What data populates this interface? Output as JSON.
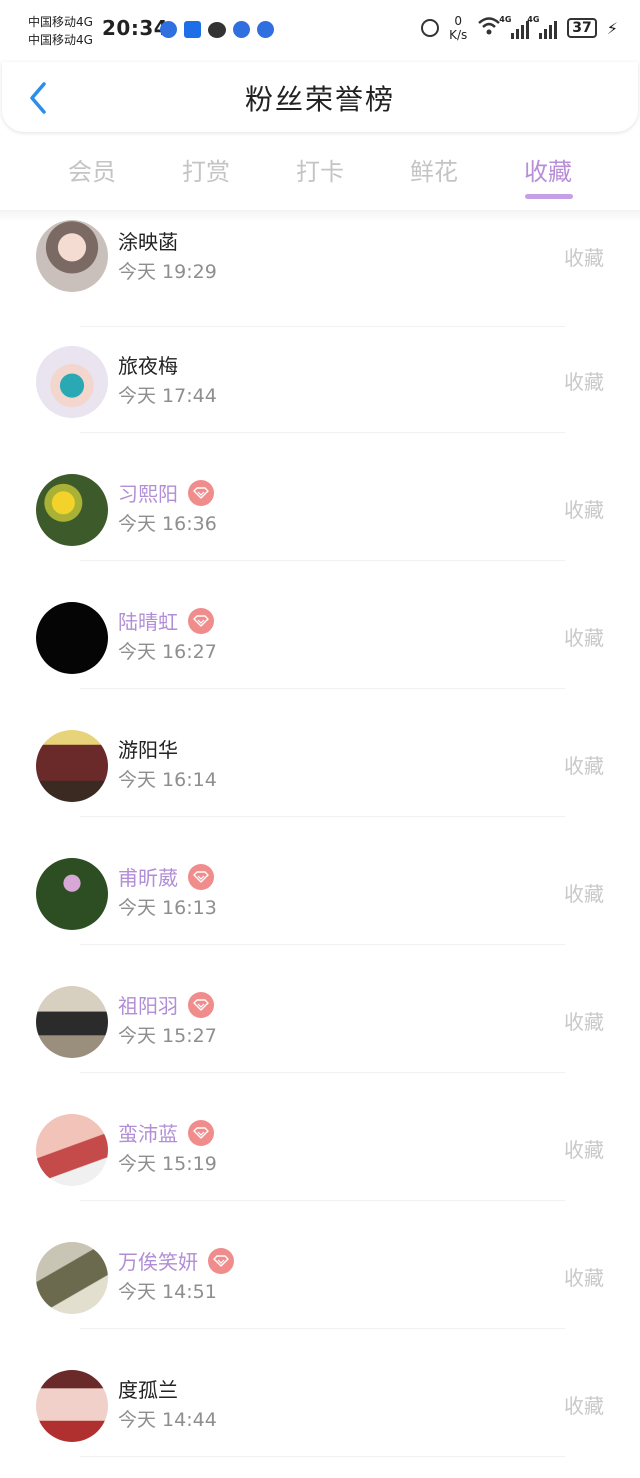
{
  "status_bar": {
    "carrier1": "中国移动4G",
    "carrier2": "中国移动4G",
    "time": "20:34",
    "net_speed_value": "0",
    "net_speed_unit": "K/s",
    "signal1_label": "4G",
    "signal2_label": "4G",
    "battery": "37"
  },
  "header": {
    "title": "粉丝荣誉榜",
    "back_icon": "chevron-left-icon"
  },
  "tabs": [
    {
      "label": "会员",
      "active": false
    },
    {
      "label": "打赏",
      "active": false
    },
    {
      "label": "打卡",
      "active": false
    },
    {
      "label": "鲜花",
      "active": false
    },
    {
      "label": "收藏",
      "active": true
    }
  ],
  "fans": [
    {
      "name": "涂映菡",
      "time": "今天 19:29",
      "vip": false,
      "action": "收藏"
    },
    {
      "name": "旅夜梅",
      "time": "今天 17:44",
      "vip": false,
      "action": "收藏"
    },
    {
      "name": "习熙阳",
      "time": "今天 16:36",
      "vip": true,
      "action": "收藏"
    },
    {
      "name": "陆晴虹",
      "time": "今天 16:27",
      "vip": true,
      "action": "收藏"
    },
    {
      "name": "游阳华",
      "time": "今天 16:14",
      "vip": false,
      "action": "收藏"
    },
    {
      "name": "甫昕葳",
      "time": "今天 16:13",
      "vip": true,
      "action": "收藏"
    },
    {
      "name": "祖阳羽",
      "time": "今天 15:27",
      "vip": true,
      "action": "收藏"
    },
    {
      "name": "蛮沛蓝",
      "time": "今天 15:19",
      "vip": true,
      "action": "收藏"
    },
    {
      "name": "万俟笑妍",
      "time": "今天 14:51",
      "vip": true,
      "action": "收藏"
    },
    {
      "name": "度孤兰",
      "time": "今天 14:44",
      "vip": false,
      "action": "收藏"
    }
  ],
  "colors": {
    "accent": "#b88ed8",
    "vip_name": "#b28ed6",
    "vip_badge": "#f08c8c",
    "back_arrow": "#2b8ee8"
  }
}
